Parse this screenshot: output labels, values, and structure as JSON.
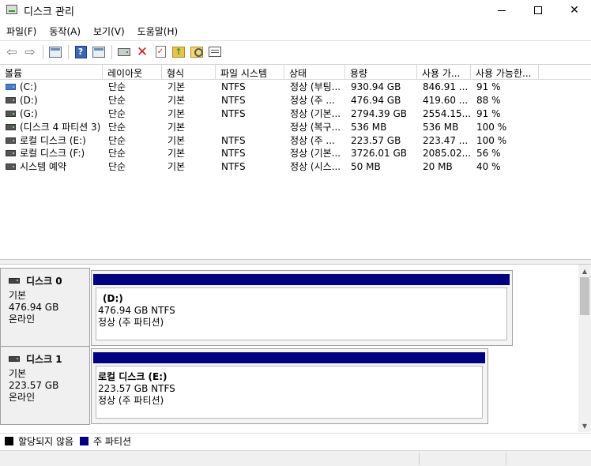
{
  "window": {
    "title": "디스크 관리"
  },
  "menu": [
    "파일(F)",
    "동작(A)",
    "보기(V)",
    "도움말(H)"
  ],
  "toolbar": {
    "buttons": [
      "back-icon",
      "forward-icon",
      "list-view-icon",
      "help-icon",
      "detail-view-icon",
      "connect-disk-icon",
      "delete-icon",
      "check-icon",
      "folder-up-icon",
      "search-icon",
      "properties-icon"
    ]
  },
  "volume_table": {
    "columns": [
      "볼륨",
      "레이아웃",
      "형식",
      "파일 시스템",
      "상태",
      "용량",
      "사용 가...",
      "사용 가능한..."
    ],
    "rows": [
      {
        "volume": "(C:)",
        "layout": "단순",
        "type": "기본",
        "fs": "NTFS",
        "status": "정상 (부팅...",
        "capacity": "930.94 GB",
        "free": "846.91 ...",
        "pct": "91 %"
      },
      {
        "volume": "(D:)",
        "layout": "단순",
        "type": "기본",
        "fs": "NTFS",
        "status": "정상 (주 ...",
        "capacity": "476.94 GB",
        "free": "419.60 ...",
        "pct": "88 %"
      },
      {
        "volume": "(G:)",
        "layout": "단순",
        "type": "기본",
        "fs": "NTFS",
        "status": "정상 (기본...",
        "capacity": "2794.39 GB",
        "free": "2554.15...",
        "pct": "91 %"
      },
      {
        "volume": "(디스크 4 파티션 3)",
        "layout": "단순",
        "type": "기본",
        "fs": "",
        "status": "정상 (복구...",
        "capacity": "536 MB",
        "free": "536 MB",
        "pct": "100 %"
      },
      {
        "volume": "로컬 디스크 (E:)",
        "layout": "단순",
        "type": "기본",
        "fs": "NTFS",
        "status": "정상 (주 ...",
        "capacity": "223.57 GB",
        "free": "223.47 ...",
        "pct": "100 %"
      },
      {
        "volume": "로컬 디스크 (F:)",
        "layout": "단순",
        "type": "기본",
        "fs": "NTFS",
        "status": "정상 (기본...",
        "capacity": "3726.01 GB",
        "free": "2085.02...",
        "pct": "56 %"
      },
      {
        "volume": "시스템 예약",
        "layout": "단순",
        "type": "기본",
        "fs": "NTFS",
        "status": "정상 (시스...",
        "capacity": "50 MB",
        "free": "20 MB",
        "pct": "40 %"
      }
    ]
  },
  "disks": [
    {
      "name": "디스크 0",
      "type": "기본",
      "size": "476.94 GB",
      "state": "온라인",
      "partition": {
        "title": "(D:)",
        "size_fs": "476.94 GB NTFS",
        "status": "정상 (주 파티션)"
      }
    },
    {
      "name": "디스크 1",
      "type": "기본",
      "size": "223.57 GB",
      "state": "온라인",
      "partition": {
        "title": "로컬 디스크  (E:)",
        "size_fs": "223.57 GB NTFS",
        "status": "정상 (주 파티션)"
      }
    }
  ],
  "legend": [
    {
      "label": "할당되지 않음",
      "color": "#000000"
    },
    {
      "label": "주 파티션",
      "color": "#000080"
    }
  ],
  "colors": {
    "primary_partition": "#000080",
    "unallocated": "#000000",
    "selection": "#4a7bd0"
  }
}
